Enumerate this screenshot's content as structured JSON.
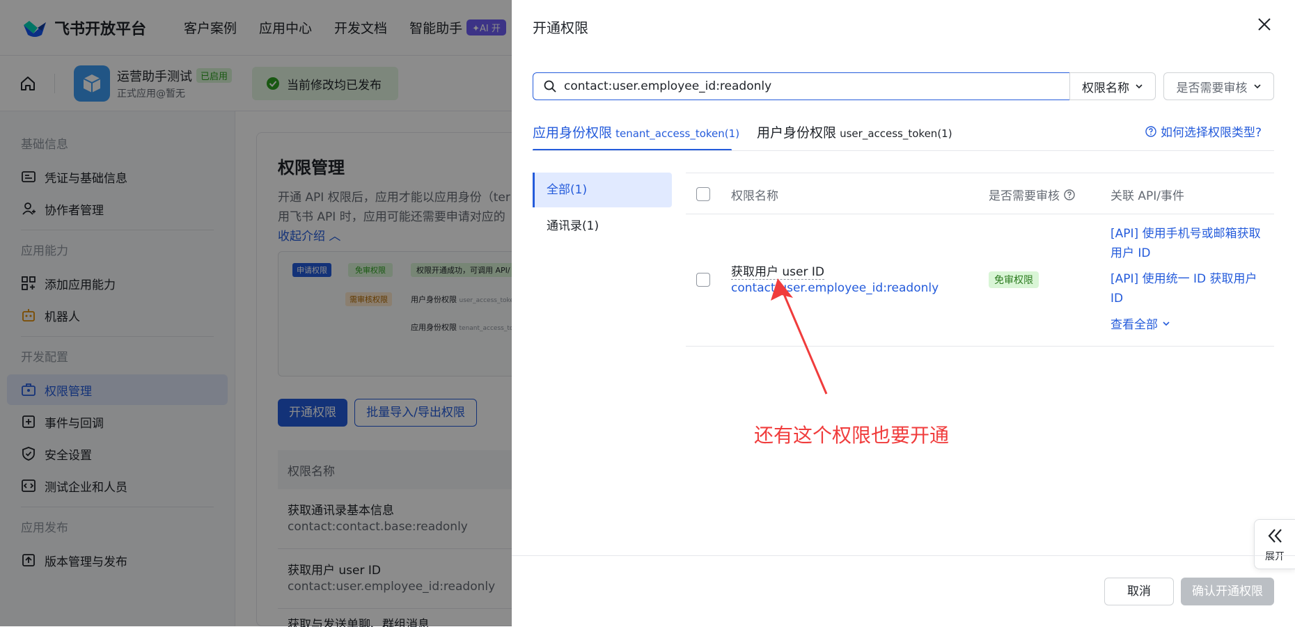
{
  "topnav": {
    "brand": "飞书开放平台",
    "items": [
      "客户案例",
      "应用中心",
      "开发文档",
      "智能助手"
    ],
    "ai_badge": "✦AI 开"
  },
  "app": {
    "name": "运营助手测试",
    "status": "已启用",
    "owner": "正式应用@暂无",
    "publish_status": "当前修改均已发布"
  },
  "sidebar": {
    "groups": [
      {
        "title": "基础信息",
        "items": [
          "凭证与基础信息",
          "协作者管理"
        ]
      },
      {
        "title": "应用能力",
        "items": [
          "添加应用能力",
          "机器人"
        ]
      },
      {
        "title": "开发配置",
        "items": [
          "权限管理",
          "事件与回调",
          "安全设置",
          "测试企业和人员"
        ]
      },
      {
        "title": "应用发布",
        "items": [
          "版本管理与发布"
        ]
      }
    ],
    "active": "权限管理"
  },
  "main": {
    "title": "权限管理",
    "desc_line1": "开通 API 权限后，应用才能以应用身份（ter",
    "desc_line2": "用飞书 API 时，应用可能还需要申请对应的",
    "collapse_link": "收起介绍",
    "diagram": {
      "apply": "申请权限",
      "free": "免审权限",
      "success": "权限开通成功，可调用 API/",
      "review": "需审核权限",
      "user_perm": "用户身份权限",
      "user_token": "user_access_token",
      "app_perm": "应用身份权限",
      "app_token": "tenant_access_token"
    },
    "btn_open": "开通权限",
    "btn_batch": "批量导入/导出权限",
    "table_header": "权限名称",
    "rows": [
      {
        "name": "获取通讯录基本信息",
        "scope": "contact:contact.base:readonly"
      },
      {
        "name": "获取用户 user ID",
        "scope": "contact:user.employee_id:readonly"
      },
      {
        "name": "获取与发送单聊、群组消息",
        "scope": ""
      }
    ]
  },
  "drawer": {
    "title": "开通权限",
    "search_value": "contact:user.employee_id:readonly",
    "filter1": "权限名称",
    "filter2": "是否需要审核",
    "tabs": [
      {
        "label": "应用身份权限",
        "sub": "tenant_access_token(1)"
      },
      {
        "label": "用户身份权限",
        "sub": "user_access_token(1)"
      }
    ],
    "help_link": "如何选择权限类型?",
    "categories": [
      "全部(1)",
      "通讯录(1)"
    ],
    "columns": [
      "权限名称",
      "是否需要审核",
      "关联 API/事件"
    ],
    "row": {
      "name": "获取用户 user ID",
      "scope": "contact:user.employee_id:readonly",
      "badge": "免审权限",
      "api1": "[API] 使用手机号或邮箱获取用户 ID",
      "api2": "[API] 使用统一 ID 获取用户 ID",
      "view_all": "查看全部"
    },
    "annotation": "还有这个权限也要开通",
    "expand_label": "展开",
    "cancel": "取消",
    "confirm": "确认开通权限"
  },
  "colors": {
    "primary": "#245bdb",
    "annotation_red": "#f03c3c",
    "success_green": "#2ea121"
  }
}
